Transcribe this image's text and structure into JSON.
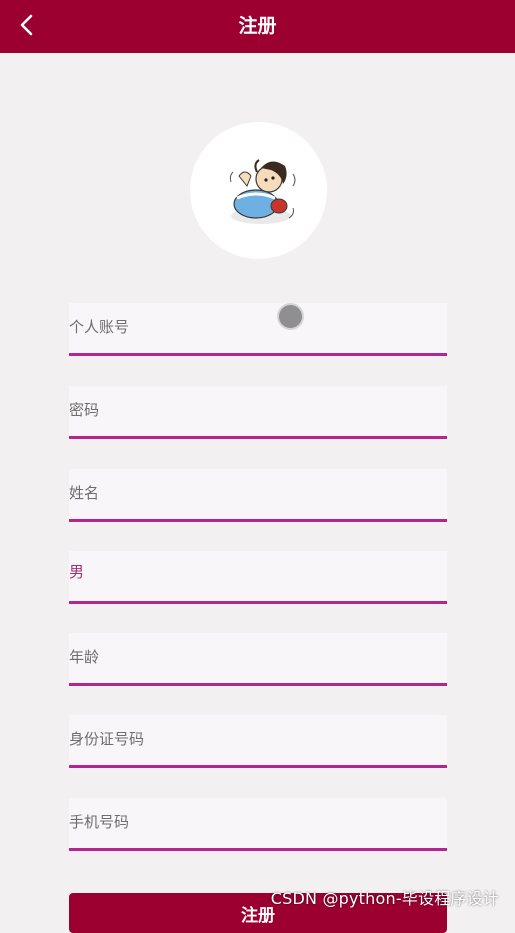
{
  "header": {
    "title": "注册",
    "back_icon": "chevron-left-icon"
  },
  "avatar": {
    "icon": "cartoon-avatar"
  },
  "form": {
    "account_placeholder": "个人账号",
    "password_placeholder": "密码",
    "name_placeholder": "姓名",
    "gender_value": "男",
    "age_placeholder": "年龄",
    "id_number_placeholder": "身份证号码",
    "phone_placeholder": "手机号码",
    "submit_label": "注册"
  },
  "watermark": {
    "text": "CSDN @python-毕设程序设计"
  },
  "colors": {
    "header_bg": "#9b0031",
    "accent_underline": "#b6248f",
    "page_bg": "#f2f0f1"
  }
}
